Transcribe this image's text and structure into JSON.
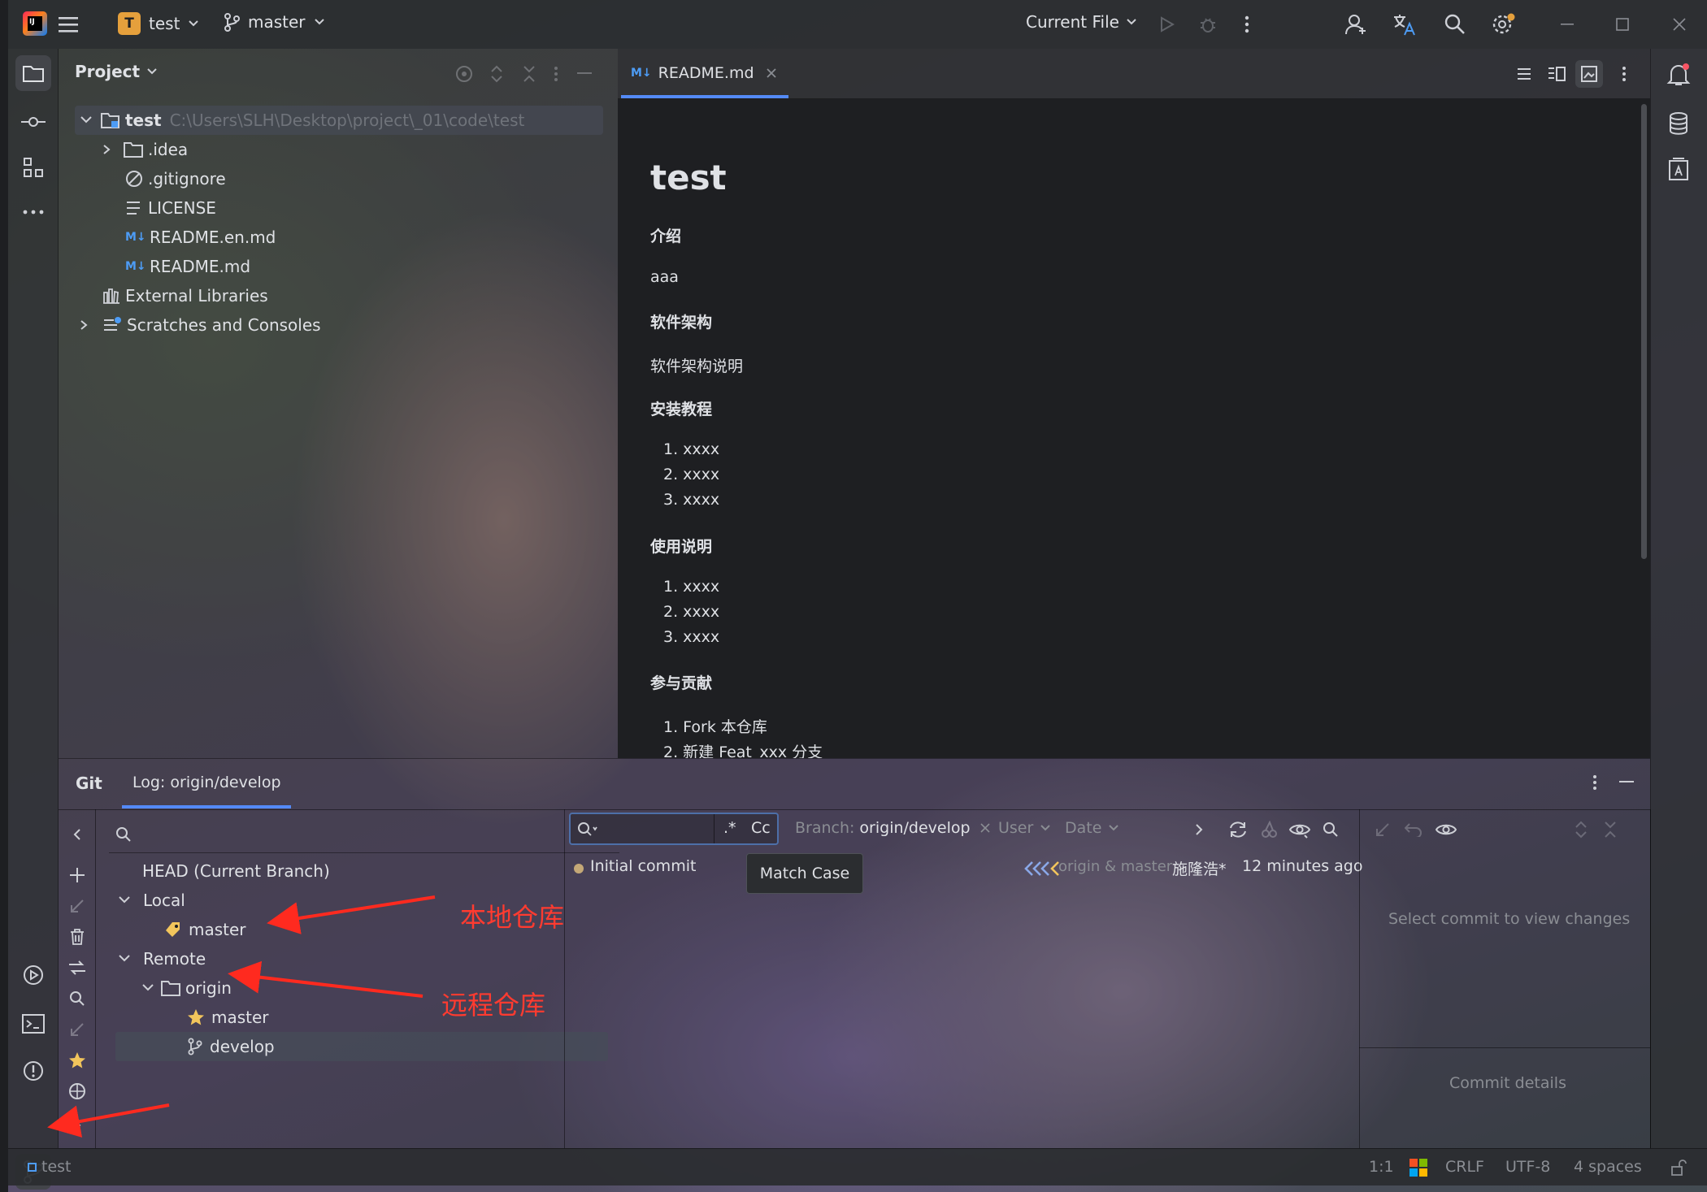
{
  "titlebar": {
    "project_initial": "T",
    "project_name": "test",
    "branch": "master",
    "run_config": "Current File"
  },
  "project_panel": {
    "title": "Project",
    "root_name": "test",
    "root_path": "C:\\Users\\SLH\\Desktop\\project\\_01\\code\\test",
    "items": [
      ".idea",
      ".gitignore",
      "LICENSE",
      "README.en.md",
      "README.md",
      "External Libraries",
      "Scratches and Consoles"
    ]
  },
  "editor": {
    "tab_label": "README.md",
    "md_badge": "M↓",
    "heading": "test",
    "sections": [
      {
        "title": "介绍",
        "body": "aaa"
      },
      {
        "title": "软件架构",
        "body": "软件架构说明"
      },
      {
        "title": "安装教程",
        "list": [
          "1. xxxx",
          "2. xxxx",
          "3. xxxx"
        ]
      },
      {
        "title": "使用说明",
        "list": [
          "1. xxxx",
          "2. xxxx",
          "3. xxxx"
        ]
      },
      {
        "title": "参与贡献",
        "list": [
          "1. Fork 本仓库",
          "2. 新建 Feat_xxx 分支"
        ]
      }
    ]
  },
  "git_panel": {
    "tab_git": "Git",
    "tab_log": "Log: origin/develop",
    "branches": {
      "head": "HEAD (Current Branch)",
      "local": "Local",
      "local_master": "master",
      "remote": "Remote",
      "origin": "origin",
      "remote_master": "master",
      "remote_develop": "develop"
    },
    "filter": {
      "regex": ".*",
      "case": "Cc",
      "branch_label": "Branch:",
      "branch_value": "origin/develop",
      "user": "User",
      "date": "Date"
    },
    "commit": {
      "message": "Initial commit",
      "refs": "origin & master",
      "author": "施隆浩*",
      "time": "12 minutes ago"
    },
    "tooltip": "Match Case",
    "details": {
      "select_commit": "Select commit to view changes",
      "commit_details": "Commit details"
    }
  },
  "annotations": {
    "local_repo": "本地仓库",
    "remote_repo": "远程仓库"
  },
  "statusbar": {
    "project": "test",
    "position": "1:1",
    "line_sep": "CRLF",
    "encoding": "UTF-8",
    "indent": "4 spaces"
  }
}
